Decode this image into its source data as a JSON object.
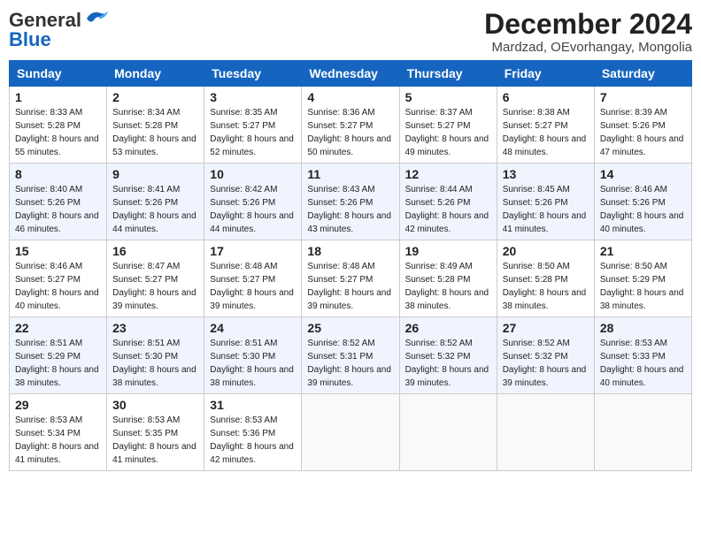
{
  "header": {
    "logo_line1": "General",
    "logo_line2": "Blue",
    "title": "December 2024",
    "location": "Mardzad, OEvorhangay, Mongolia"
  },
  "days_of_week": [
    "Sunday",
    "Monday",
    "Tuesday",
    "Wednesday",
    "Thursday",
    "Friday",
    "Saturday"
  ],
  "weeks": [
    [
      {
        "day": "1",
        "sunrise": "Sunrise: 8:33 AM",
        "sunset": "Sunset: 5:28 PM",
        "daylight": "Daylight: 8 hours and 55 minutes."
      },
      {
        "day": "2",
        "sunrise": "Sunrise: 8:34 AM",
        "sunset": "Sunset: 5:28 PM",
        "daylight": "Daylight: 8 hours and 53 minutes."
      },
      {
        "day": "3",
        "sunrise": "Sunrise: 8:35 AM",
        "sunset": "Sunset: 5:27 PM",
        "daylight": "Daylight: 8 hours and 52 minutes."
      },
      {
        "day": "4",
        "sunrise": "Sunrise: 8:36 AM",
        "sunset": "Sunset: 5:27 PM",
        "daylight": "Daylight: 8 hours and 50 minutes."
      },
      {
        "day": "5",
        "sunrise": "Sunrise: 8:37 AM",
        "sunset": "Sunset: 5:27 PM",
        "daylight": "Daylight: 8 hours and 49 minutes."
      },
      {
        "day": "6",
        "sunrise": "Sunrise: 8:38 AM",
        "sunset": "Sunset: 5:27 PM",
        "daylight": "Daylight: 8 hours and 48 minutes."
      },
      {
        "day": "7",
        "sunrise": "Sunrise: 8:39 AM",
        "sunset": "Sunset: 5:26 PM",
        "daylight": "Daylight: 8 hours and 47 minutes."
      }
    ],
    [
      {
        "day": "8",
        "sunrise": "Sunrise: 8:40 AM",
        "sunset": "Sunset: 5:26 PM",
        "daylight": "Daylight: 8 hours and 46 minutes."
      },
      {
        "day": "9",
        "sunrise": "Sunrise: 8:41 AM",
        "sunset": "Sunset: 5:26 PM",
        "daylight": "Daylight: 8 hours and 44 minutes."
      },
      {
        "day": "10",
        "sunrise": "Sunrise: 8:42 AM",
        "sunset": "Sunset: 5:26 PM",
        "daylight": "Daylight: 8 hours and 44 minutes."
      },
      {
        "day": "11",
        "sunrise": "Sunrise: 8:43 AM",
        "sunset": "Sunset: 5:26 PM",
        "daylight": "Daylight: 8 hours and 43 minutes."
      },
      {
        "day": "12",
        "sunrise": "Sunrise: 8:44 AM",
        "sunset": "Sunset: 5:26 PM",
        "daylight": "Daylight: 8 hours and 42 minutes."
      },
      {
        "day": "13",
        "sunrise": "Sunrise: 8:45 AM",
        "sunset": "Sunset: 5:26 PM",
        "daylight": "Daylight: 8 hours and 41 minutes."
      },
      {
        "day": "14",
        "sunrise": "Sunrise: 8:46 AM",
        "sunset": "Sunset: 5:26 PM",
        "daylight": "Daylight: 8 hours and 40 minutes."
      }
    ],
    [
      {
        "day": "15",
        "sunrise": "Sunrise: 8:46 AM",
        "sunset": "Sunset: 5:27 PM",
        "daylight": "Daylight: 8 hours and 40 minutes."
      },
      {
        "day": "16",
        "sunrise": "Sunrise: 8:47 AM",
        "sunset": "Sunset: 5:27 PM",
        "daylight": "Daylight: 8 hours and 39 minutes."
      },
      {
        "day": "17",
        "sunrise": "Sunrise: 8:48 AM",
        "sunset": "Sunset: 5:27 PM",
        "daylight": "Daylight: 8 hours and 39 minutes."
      },
      {
        "day": "18",
        "sunrise": "Sunrise: 8:48 AM",
        "sunset": "Sunset: 5:27 PM",
        "daylight": "Daylight: 8 hours and 39 minutes."
      },
      {
        "day": "19",
        "sunrise": "Sunrise: 8:49 AM",
        "sunset": "Sunset: 5:28 PM",
        "daylight": "Daylight: 8 hours and 38 minutes."
      },
      {
        "day": "20",
        "sunrise": "Sunrise: 8:50 AM",
        "sunset": "Sunset: 5:28 PM",
        "daylight": "Daylight: 8 hours and 38 minutes."
      },
      {
        "day": "21",
        "sunrise": "Sunrise: 8:50 AM",
        "sunset": "Sunset: 5:29 PM",
        "daylight": "Daylight: 8 hours and 38 minutes."
      }
    ],
    [
      {
        "day": "22",
        "sunrise": "Sunrise: 8:51 AM",
        "sunset": "Sunset: 5:29 PM",
        "daylight": "Daylight: 8 hours and 38 minutes."
      },
      {
        "day": "23",
        "sunrise": "Sunrise: 8:51 AM",
        "sunset": "Sunset: 5:30 PM",
        "daylight": "Daylight: 8 hours and 38 minutes."
      },
      {
        "day": "24",
        "sunrise": "Sunrise: 8:51 AM",
        "sunset": "Sunset: 5:30 PM",
        "daylight": "Daylight: 8 hours and 38 minutes."
      },
      {
        "day": "25",
        "sunrise": "Sunrise: 8:52 AM",
        "sunset": "Sunset: 5:31 PM",
        "daylight": "Daylight: 8 hours and 39 minutes."
      },
      {
        "day": "26",
        "sunrise": "Sunrise: 8:52 AM",
        "sunset": "Sunset: 5:32 PM",
        "daylight": "Daylight: 8 hours and 39 minutes."
      },
      {
        "day": "27",
        "sunrise": "Sunrise: 8:52 AM",
        "sunset": "Sunset: 5:32 PM",
        "daylight": "Daylight: 8 hours and 39 minutes."
      },
      {
        "day": "28",
        "sunrise": "Sunrise: 8:53 AM",
        "sunset": "Sunset: 5:33 PM",
        "daylight": "Daylight: 8 hours and 40 minutes."
      }
    ],
    [
      {
        "day": "29",
        "sunrise": "Sunrise: 8:53 AM",
        "sunset": "Sunset: 5:34 PM",
        "daylight": "Daylight: 8 hours and 41 minutes."
      },
      {
        "day": "30",
        "sunrise": "Sunrise: 8:53 AM",
        "sunset": "Sunset: 5:35 PM",
        "daylight": "Daylight: 8 hours and 41 minutes."
      },
      {
        "day": "31",
        "sunrise": "Sunrise: 8:53 AM",
        "sunset": "Sunset: 5:36 PM",
        "daylight": "Daylight: 8 hours and 42 minutes."
      },
      null,
      null,
      null,
      null
    ]
  ]
}
